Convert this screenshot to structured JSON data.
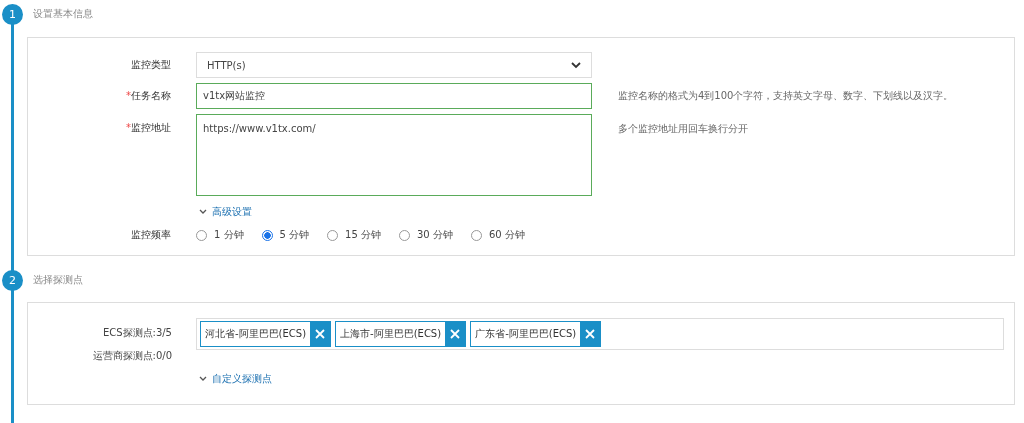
{
  "steps": [
    {
      "number": "1",
      "title": "设置基本信息",
      "kind": "basic",
      "monitor_type": {
        "label": "监控类型",
        "value": "HTTP(s)"
      },
      "task_name": {
        "required_mark": "*",
        "label": "任务名称",
        "value": "v1tx网站监控",
        "hint": "监控名称的格式为4到100个字符，支持英文字母、数字、下划线以及汉字。"
      },
      "monitor_url": {
        "required_mark": "*",
        "label": "监控地址",
        "value": "https://www.v1tx.com/",
        "hint": "多个监控地址用回车换行分开"
      },
      "advanced_link": "高级设置",
      "frequency": {
        "label": "监控频率",
        "options": [
          {
            "label": "1 分钟",
            "selected": false
          },
          {
            "label": "5 分钟",
            "selected": true
          },
          {
            "label": "15 分钟",
            "selected": false
          },
          {
            "label": "30 分钟",
            "selected": false
          },
          {
            "label": "60 分钟",
            "selected": false
          }
        ]
      }
    },
    {
      "number": "2",
      "title": "选择探测点",
      "kind": "probes",
      "counts": [
        "ECS探测点:3/5",
        "运营商探测点:0/0"
      ],
      "tags": [
        "河北省-阿里巴巴(ECS)",
        "上海市-阿里巴巴(ECS)",
        "广东省-阿里巴巴(ECS)"
      ],
      "custom_link": "自定义探测点"
    }
  ]
}
